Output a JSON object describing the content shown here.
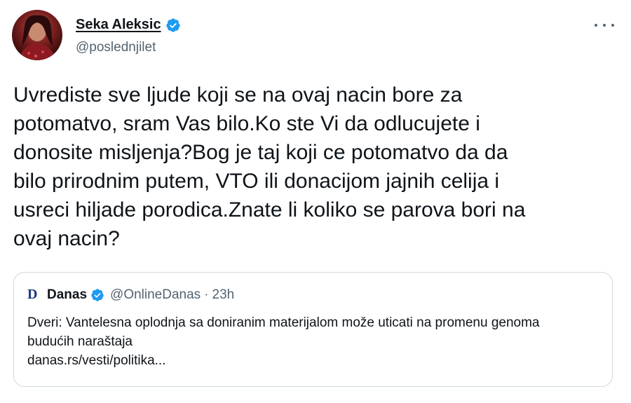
{
  "author": {
    "display_name": "Seka Aleksic",
    "handle": "@poslednjilet",
    "verified": true,
    "avatar_icon": "profile-photo"
  },
  "more_icon": "more-horizontal-icon",
  "tweet": {
    "text": "Uvrediste sve ljude koji se na ovaj nacin bore za\npotomatvo, sram Vas bilo.Ko ste Vi da odlucujete i\ndonosite misljenja?Bog je taj koji ce potomatvo da da\nbilo prirodnim putem, VTO ili donacijom jajnih celija i\nusreci hiljade porodica.Znate li koliko se parova bori na\novaj nacin?"
  },
  "quoted_tweet": {
    "logo_text": "D",
    "display_name": "Danas",
    "verified": true,
    "handle": "@OnlineDanas",
    "separator": "·",
    "time": "23h",
    "text": "Dveri: Vantelesna oplodnja sa doniranim materijalom može uticati na promenu genoma budućih naraštaja",
    "link": "danas.rs/vesti/politika..."
  },
  "colors": {
    "verified_blue": "#1d9bf0",
    "secondary_text": "#536471",
    "border": "#cfd9de"
  }
}
